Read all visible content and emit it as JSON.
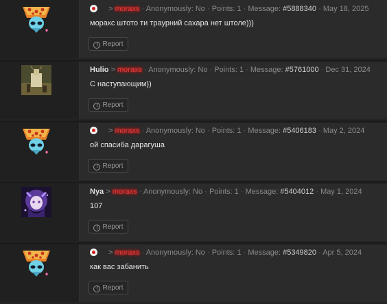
{
  "posts": [
    {
      "avatar": "pizza-alien-avatar",
      "username": "",
      "has_user_icon": true,
      "arrow": ">",
      "target": "moraxs",
      "anon": "Anonymously: No",
      "points": "Points: 1",
      "message_label": "Message:",
      "message_id": "#5888340",
      "date": "May 18, 2025",
      "text": "моракс штото ти траурний сахара нет штоле)))",
      "report": "Report"
    },
    {
      "avatar": "deer-avatar",
      "username": "Hulio",
      "has_user_icon": false,
      "arrow": ">",
      "target": "moraxs",
      "anon": "Anonymously: No",
      "points": "Points: 1",
      "message_label": "Message:",
      "message_id": "#5761000",
      "date": "Dec 31, 2024",
      "text": "С наступающим))",
      "report": "Report"
    },
    {
      "avatar": "pizza-alien-avatar",
      "username": "",
      "has_user_icon": true,
      "arrow": ">",
      "target": "moraxs",
      "anon": "Anonymously: No",
      "points": "Points: 1",
      "message_label": "Message:",
      "message_id": "#5406183",
      "date": "May 2, 2024",
      "text": "ой спасиба дарагуша",
      "report": "Report"
    },
    {
      "avatar": "purple-girl-avatar",
      "username": "Nya",
      "has_user_icon": false,
      "arrow": ">",
      "target": "moraxs",
      "anon": "Anonymously: No",
      "points": "Points: 1",
      "message_label": "Message:",
      "message_id": "#5404012",
      "date": "May 1, 2024",
      "text": "107",
      "report": "Report"
    },
    {
      "avatar": "pizza-alien-avatar",
      "username": "",
      "has_user_icon": true,
      "arrow": ">",
      "target": "moraxs",
      "anon": "Anonymously: No",
      "points": "Points: 1",
      "message_label": "Message:",
      "message_id": "#5349820",
      "date": "Apr 5, 2024",
      "text": "как вас забанить",
      "report": "Report"
    }
  ],
  "separator": "·",
  "colors": {
    "background": "#2b2b2b",
    "target_name": "#d63a3a",
    "text": "#e6e6e6"
  }
}
